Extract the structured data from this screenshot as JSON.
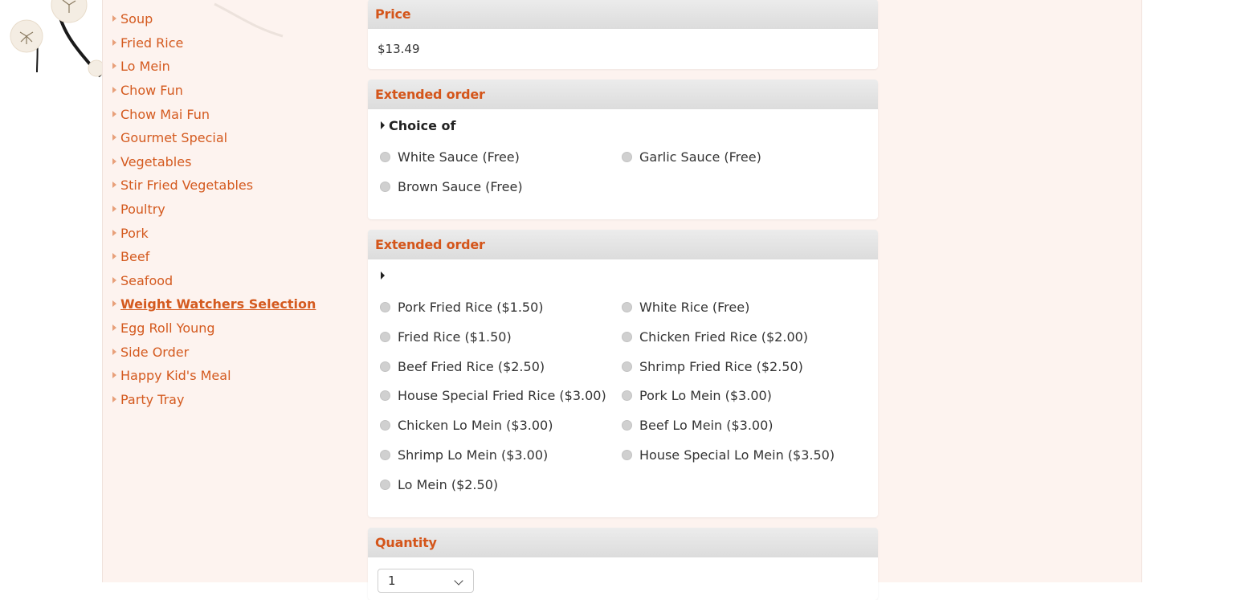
{
  "sidebar": {
    "items": [
      {
        "label": "Soup"
      },
      {
        "label": "Fried Rice"
      },
      {
        "label": "Lo Mein"
      },
      {
        "label": "Chow Fun"
      },
      {
        "label": "Chow Mai Fun"
      },
      {
        "label": "Gourmet Special"
      },
      {
        "label": "Vegetables"
      },
      {
        "label": "Stir Fried Vegetables"
      },
      {
        "label": "Poultry"
      },
      {
        "label": "Pork"
      },
      {
        "label": "Beef"
      },
      {
        "label": "Seafood"
      },
      {
        "label": "Weight Watchers Selection",
        "active": true
      },
      {
        "label": "Egg Roll Young"
      },
      {
        "label": "Side Order"
      },
      {
        "label": "Happy Kid's Meal"
      },
      {
        "label": "Party Tray"
      }
    ]
  },
  "price": {
    "heading": "Price",
    "value": "$13.49"
  },
  "sauce_panel": {
    "heading": "Extended order",
    "choice_label": "Choice of",
    "options": [
      {
        "label": "White Sauce (Free)"
      },
      {
        "label": "Garlic Sauce (Free)"
      },
      {
        "label": "Brown Sauce (Free)"
      }
    ]
  },
  "side_panel": {
    "heading": "Extended order",
    "choice_label": "",
    "options": [
      {
        "label": "Pork Fried Rice ($1.50)"
      },
      {
        "label": "White Rice (Free)"
      },
      {
        "label": "Fried Rice ($1.50)"
      },
      {
        "label": "Chicken Fried Rice ($2.00)"
      },
      {
        "label": "Beef Fried Rice ($2.50)"
      },
      {
        "label": "Shrimp Fried Rice ($2.50)"
      },
      {
        "label": "House Special Fried Rice ($3.00)"
      },
      {
        "label": "Pork Lo Mein ($3.00)"
      },
      {
        "label": "Chicken Lo Mein ($3.00)"
      },
      {
        "label": "Beef Lo Mein ($3.00)"
      },
      {
        "label": "Shrimp Lo Mein ($3.00)"
      },
      {
        "label": "House Special Lo Mein ($3.50)"
      },
      {
        "label": "Lo Mein ($2.50)"
      }
    ]
  },
  "quantity": {
    "heading": "Quantity",
    "value": "1"
  },
  "colors": {
    "accent": "#d4551a",
    "page_bg": "#fdf3ef",
    "panel_head": "#e3e3e3"
  }
}
